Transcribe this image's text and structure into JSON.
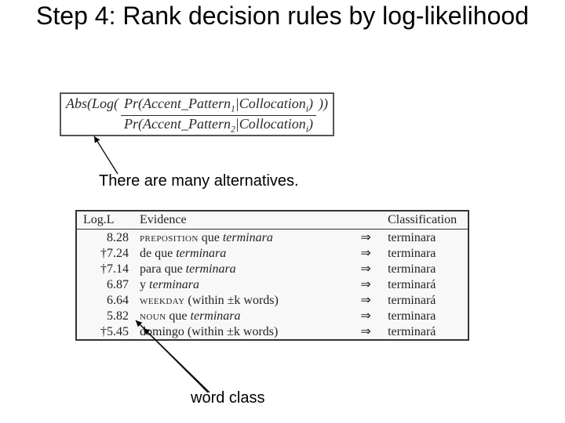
{
  "title": "Step 4: Rank decision rules by log-likelihood",
  "formula": {
    "prefix": "Abs(Log(",
    "num_left": "Pr(Accent_Pattern",
    "num_sub": "1",
    "num_mid": "|Collocation",
    "num_sub2": "i",
    "num_right": ")",
    "den_left": "Pr(Accent_Pattern",
    "den_sub": "2",
    "den_mid": "|Collocation",
    "den_sub2": "i",
    "den_right": ")",
    "suffix": "))"
  },
  "caption_alternatives": "There are many alternatives.",
  "caption_wordclass": "word class",
  "arrow_glyph": "⇒",
  "chart_data": {
    "type": "table",
    "title": "Ranked decision rules by log-likelihood",
    "columns": [
      "Log.L",
      "Evidence",
      "Classification"
    ],
    "rows": [
      {
        "dagger": false,
        "logl": "8.28",
        "evidence_sc": "preposition",
        "evidence_rest": " que ",
        "evidence_ital": "terminara",
        "arrow": "⇒",
        "classification": "terminara"
      },
      {
        "dagger": true,
        "logl": "7.24",
        "evidence_sc": "",
        "evidence_rest": "de que ",
        "evidence_ital": "terminara",
        "arrow": "⇒",
        "classification": "terminara"
      },
      {
        "dagger": true,
        "logl": "7.14",
        "evidence_sc": "",
        "evidence_rest": "para que ",
        "evidence_ital": "terminara",
        "arrow": "⇒",
        "classification": "terminara"
      },
      {
        "dagger": false,
        "logl": "6.87",
        "evidence_sc": "",
        "evidence_rest": "y ",
        "evidence_ital": "terminara",
        "arrow": "⇒",
        "classification": "terminará"
      },
      {
        "dagger": false,
        "logl": "6.64",
        "evidence_sc": "weekday",
        "evidence_rest": " (within ±k words)",
        "evidence_ital": "",
        "arrow": "⇒",
        "classification": "terminará"
      },
      {
        "dagger": false,
        "logl": "5.82",
        "evidence_sc": "noun",
        "evidence_rest": " que ",
        "evidence_ital": "terminara",
        "arrow": "⇒",
        "classification": "terminara"
      },
      {
        "dagger": true,
        "logl": "5.45",
        "evidence_sc": "",
        "evidence_rest": "domingo (within ±k words)",
        "evidence_ital": "",
        "arrow": "⇒",
        "classification": "terminará"
      }
    ]
  }
}
